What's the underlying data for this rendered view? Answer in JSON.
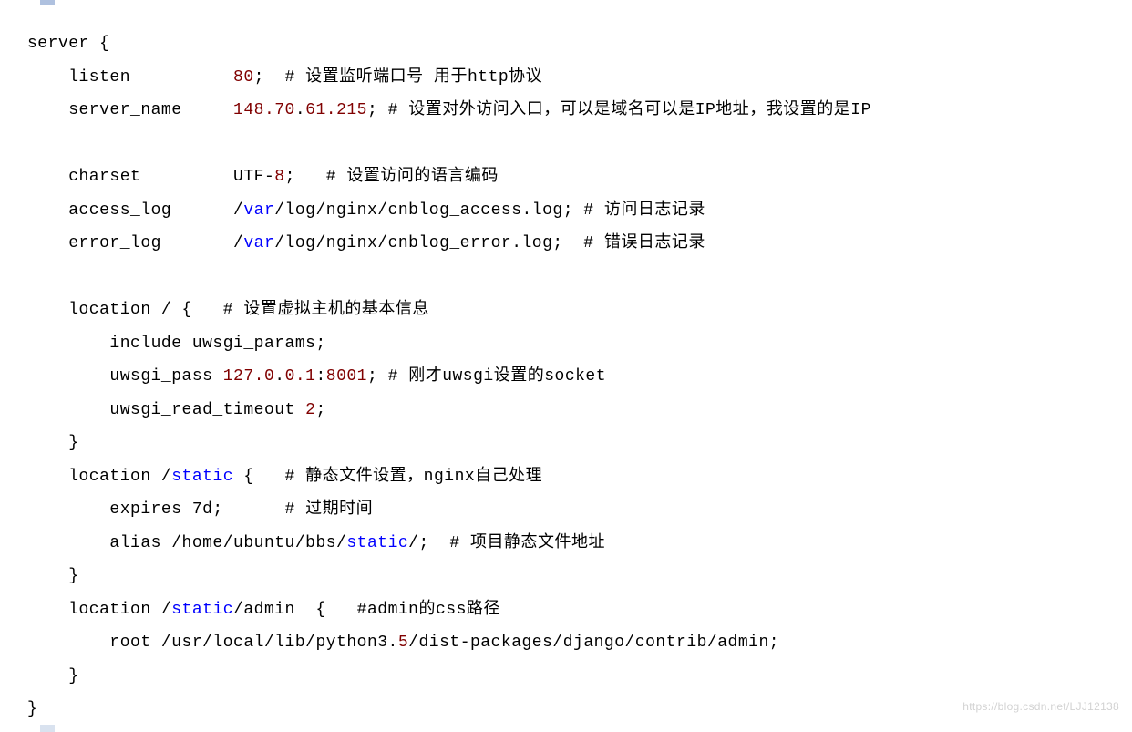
{
  "code": {
    "l1": "server {",
    "l2_a": "    listen          ",
    "l2_b": "80",
    "l2_c": ";  # 设置监听端口号 用于http协议",
    "l3_a": "    server_name     ",
    "l3_b": "148.70",
    "l3_c": ".",
    "l3_d": "61.215",
    "l3_e": "; # 设置对外访问入口，可以是域名可以是IP地址，我设置的是IP",
    "l4": "",
    "l5_a": "    charset         UTF-",
    "l5_b": "8",
    "l5_c": ";   # 设置访问的语言编码",
    "l6_a": "    access_log      /",
    "l6_b": "var",
    "l6_c": "/log/nginx/cnblog_access.log; # 访问日志记录",
    "l7_a": "    error_log       /",
    "l7_b": "var",
    "l7_c": "/log/nginx/cnblog_error.log;  # 错误日志记录",
    "l8": "",
    "l9": "    location / {   # 设置虚拟主机的基本信息",
    "l10": "        include uwsgi_params;",
    "l11_a": "        uwsgi_pass ",
    "l11_b": "127.0",
    "l11_c": ".",
    "l11_d": "0.1",
    "l11_e": ":",
    "l11_f": "8001",
    "l11_g": "; # 刚才uwsgi设置的socket",
    "l12_a": "        uwsgi_read_timeout ",
    "l12_b": "2",
    "l12_c": ";",
    "l13": "    }",
    "l14_a": "    location /",
    "l14_b": "static",
    "l14_c": " {   # 静态文件设置，nginx自己处理",
    "l15": "        expires 7d;      # 过期时间",
    "l16_a": "        alias /home/ubuntu/bbs/",
    "l16_b": "static",
    "l16_c": "/;  # 项目静态文件地址",
    "l17": "    }",
    "l18_a": "    location /",
    "l18_b": "static",
    "l18_c": "/admin  {   #admin的css路径",
    "l19_a": "        root /usr/local/lib/python3.",
    "l19_b": "5",
    "l19_c": "/dist-packages/django/contrib/admin;",
    "l20": "    }",
    "l21": "}"
  },
  "watermark": "https://blog.csdn.net/LJJ12138"
}
